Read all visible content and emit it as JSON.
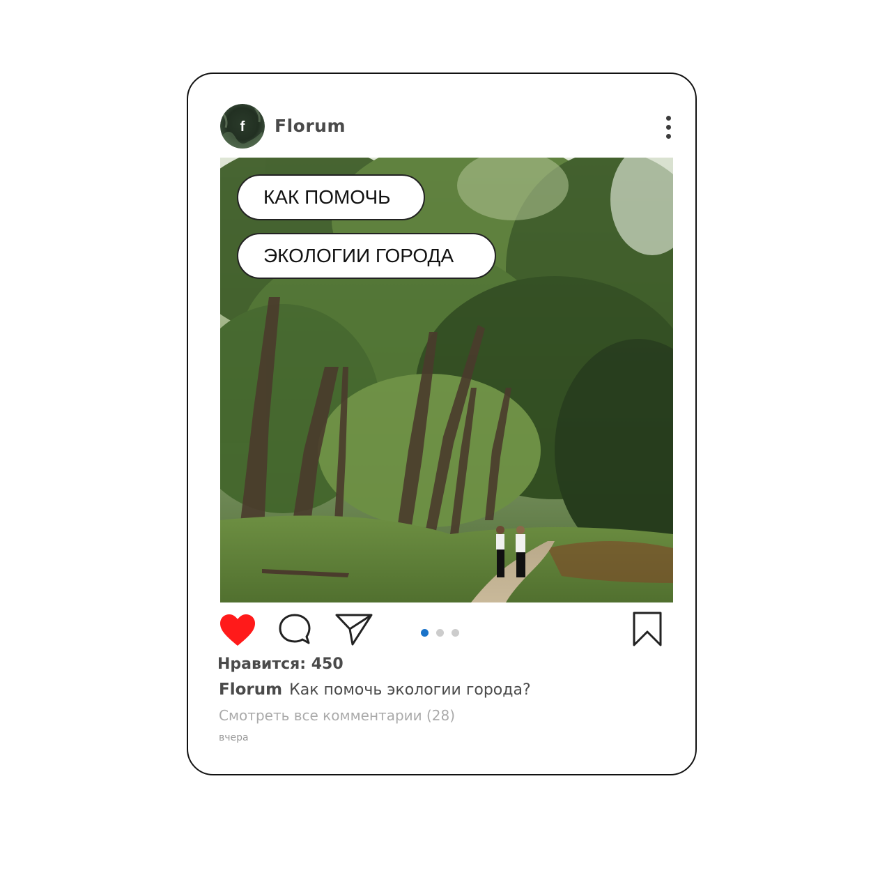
{
  "post": {
    "username": "Florum",
    "avatar_letter": "f",
    "image_overlay": {
      "line1": "КАК ПОМОЧЬ",
      "line2": "ЭКОЛОГИИ ГОРОДА"
    },
    "likes_text": "Нравится: 450",
    "caption_user": "Florum",
    "caption_text": "Как помочь экологии города?",
    "view_comments": "Смотреть все комментарии (28)",
    "timestamp": "вчера",
    "carousel": {
      "count": 3,
      "active_index": 0
    }
  },
  "icons": {
    "avatar": "brand-avatar-icon",
    "more": "more-vertical-icon",
    "like": "heart-filled-icon",
    "comment": "comment-bubble-icon",
    "share": "paper-plane-icon",
    "save": "bookmark-icon"
  },
  "colors": {
    "like_red": "#ff1a1a",
    "carousel_active": "#1a73c9",
    "carousel_inactive": "#cccccc",
    "text_dark": "#4a4a4a",
    "text_muted": "#aaaaaa"
  }
}
